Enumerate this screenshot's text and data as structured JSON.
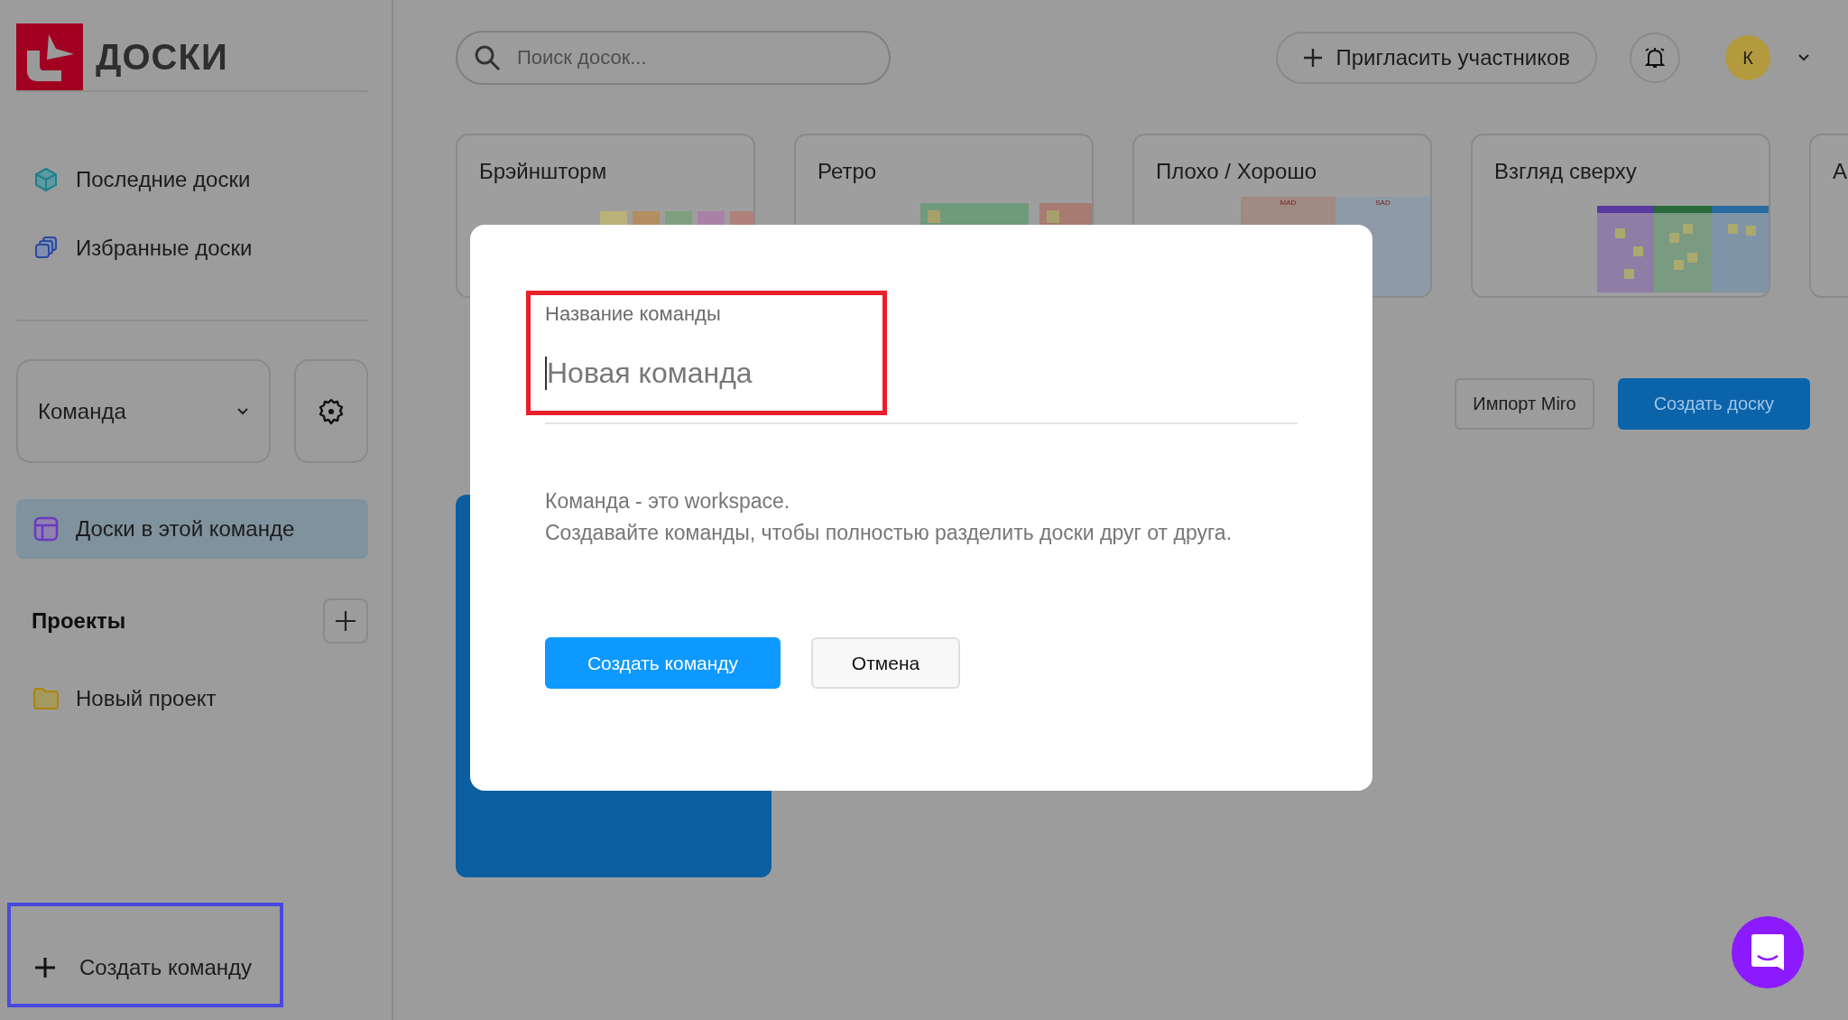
{
  "logo": {
    "text": "ДОСКИ"
  },
  "sidebar": {
    "nav": [
      {
        "label": "Последние доски",
        "selected": false
      },
      {
        "label": "Избранные доски",
        "selected": false
      }
    ],
    "team_select": {
      "value": "Команда"
    },
    "team_nav": [
      {
        "label": "Доски в этой команде",
        "selected": true
      }
    ],
    "projects": {
      "title": "Проекты",
      "items": [
        {
          "label": "Новый проект"
        }
      ]
    },
    "create_team": {
      "label": "Создать команду",
      "highlighted": true
    }
  },
  "search": {
    "placeholder": "Поиск досок..."
  },
  "invite_button": "Пригласить участников",
  "avatar": "К",
  "templates": [
    {
      "title": "Брэйншторм",
      "kind": "stickies"
    },
    {
      "title": "Ретро",
      "kind": "retro"
    },
    {
      "title": "Плохо / Хорошо",
      "kind": "columns",
      "labels": [
        "MAD",
        "SAD"
      ]
    },
    {
      "title": "Взгляд сверху",
      "kind": "grid"
    },
    {
      "title": "А",
      "kind": "none"
    }
  ],
  "actions": [
    {
      "label": "Импорт Miro",
      "kind": "secondary"
    },
    {
      "label": "Создать доску",
      "kind": "primary"
    }
  ],
  "dialog": {
    "field_label": "Название команды",
    "placeholder": "Новая команда",
    "highlighted": true,
    "description": [
      "Команда - это workspace.",
      "Создавайте команды, чтобы полностью разделить доски друг от друга."
    ],
    "buttons": [
      {
        "label": "Создать команду",
        "kind": "primary"
      },
      {
        "label": "Отмена",
        "kind": "secondary"
      }
    ]
  }
}
